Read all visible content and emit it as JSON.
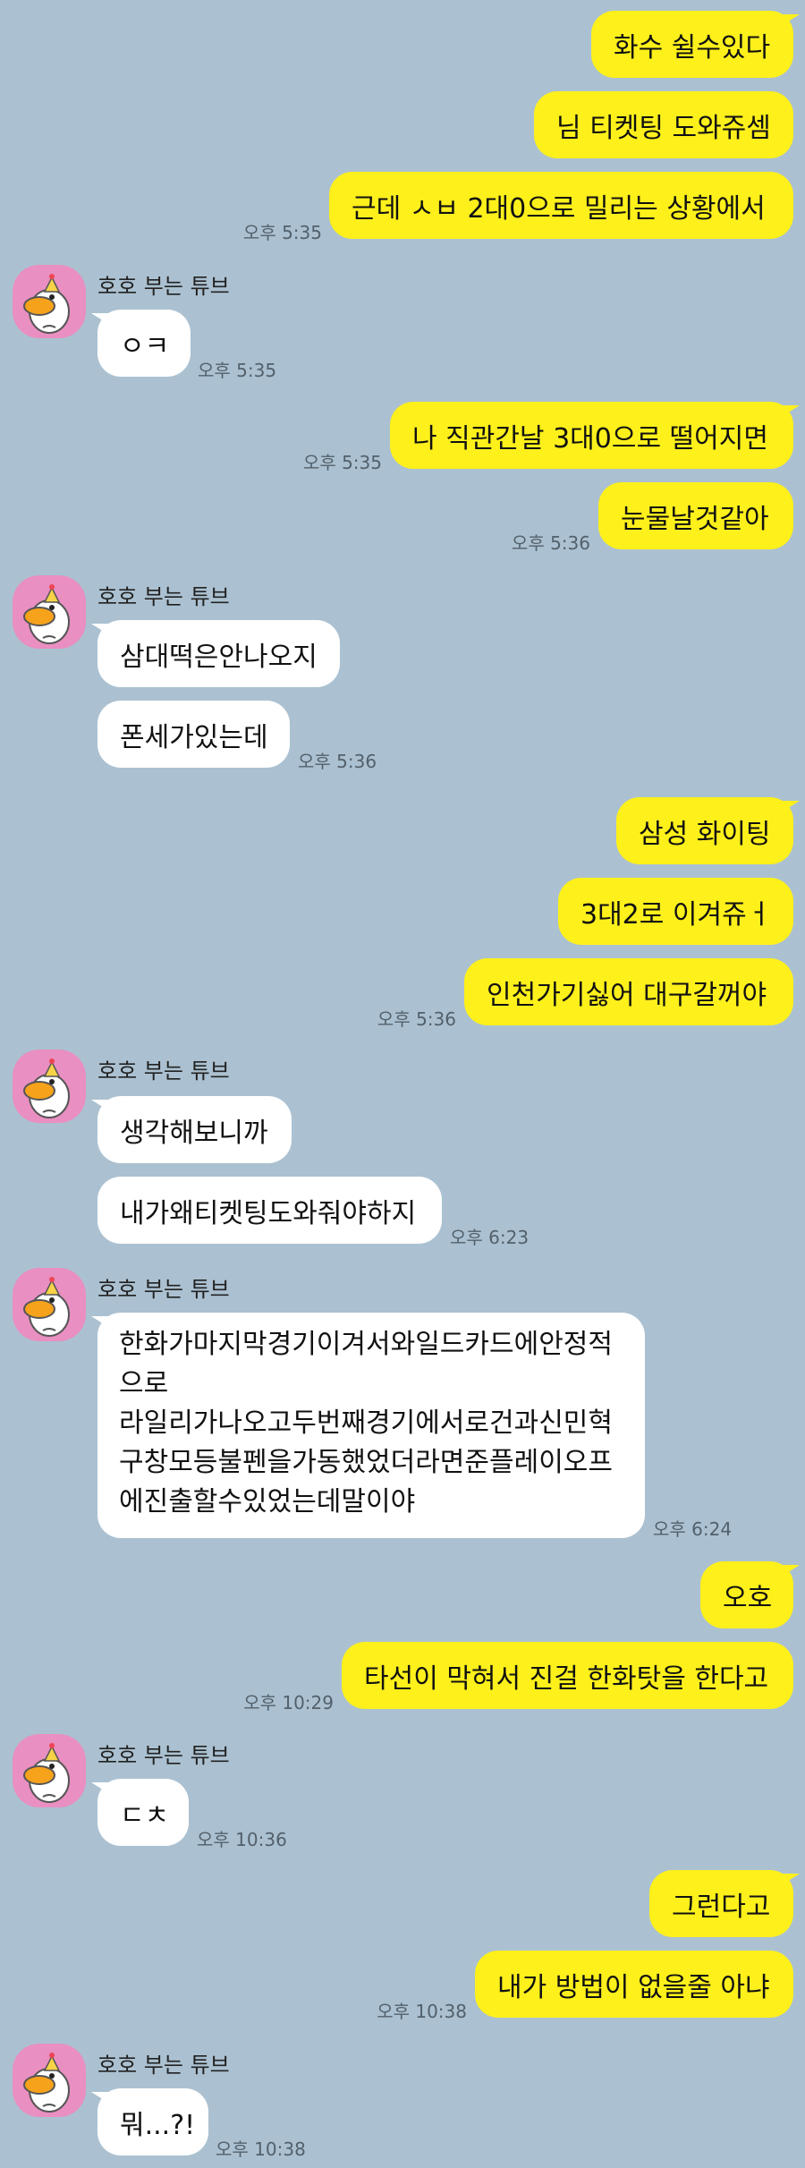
{
  "contact": {
    "name": "호호 부는 튜브"
  },
  "messages": {
    "m1": "화수 쉴수있다",
    "m2": "님 티켓팅 도와쥬셈",
    "m3": "근데 ㅅㅂ 2대0으로 밀리는 상황에서",
    "m4": "ㅇㅋ",
    "m5": "나 직관간날 3대0으로 떨어지면",
    "m6": "눈물날것같아",
    "m7": "삼대떡은안나오지",
    "m8": "폰세가있는데",
    "m9": "삼성 화이팅",
    "m10": "3대2로 이겨쥬ㅓ",
    "m11": "인천가기싫어 대구갈꺼야",
    "m12": "생각해보니까",
    "m13": "내가왜티켓팅도와줘야하지",
    "m14": [
      "한화가마지막경기이겨서와일드카드에안정적",
      "으로",
      "라일리가나오고두번째경기에서로건과신민혁",
      "구창모등불펜을가동했었더라면준플레이오프",
      "에진출할수있었는데말이야"
    ],
    "m15": "오호",
    "m16": "타선이 막혀서 진걸 한화탓을 한다고",
    "m17": "ㄷㅊ",
    "m18": "그런다고",
    "m19": "내가 방법이 없을줄 아냐",
    "m20": "뭐...?!"
  },
  "times": {
    "t1": "오후 5:35",
    "t2": "오후 5:35",
    "t3": "오후 5:35",
    "t4": "오후 5:36",
    "t5": "오후 5:36",
    "t6": "오후 5:36",
    "t7": "오후 6:23",
    "t8": "오후 6:24",
    "t9": "오후 10:29",
    "t10": "오후 10:36",
    "t11": "오후 10:38",
    "t12": "오후 10:38"
  },
  "colors": {
    "background": "#abc1d1",
    "my_bubble": "#fef01b",
    "their_bubble": "#ffffff",
    "avatar_bg": "#e98fc1"
  },
  "icons": {
    "avatar": "tube-duck-avatar"
  }
}
